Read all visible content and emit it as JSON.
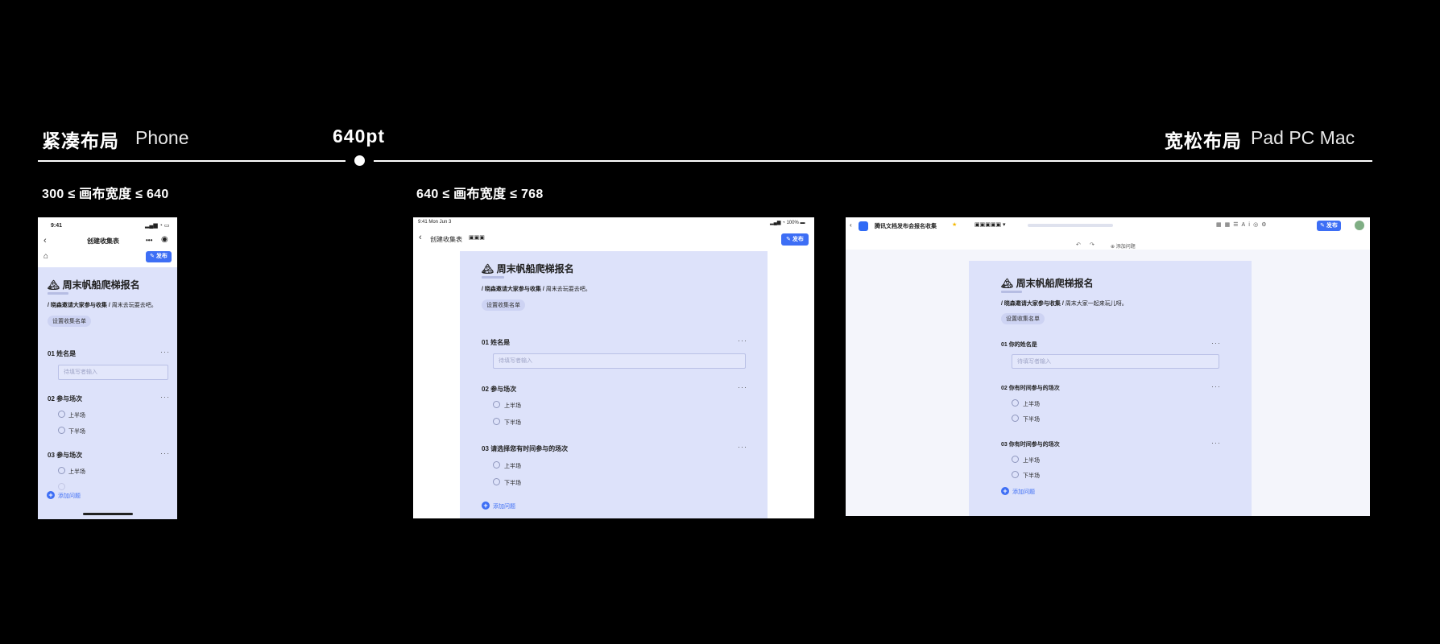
{
  "header": {
    "compact_label": "紧凑布局",
    "compact_devices": "Phone",
    "breakpoint": "640pt",
    "loose_label": "宽松布局",
    "loose_devices": "Pad PC Mac"
  },
  "ranges": {
    "phone": "300 ≤ 画布宽度 ≤ 640",
    "pad": "640 ≤ 画布宽度 ≤ 768"
  },
  "phone": {
    "time": "9:41",
    "title": "创建收集表",
    "publish": "发布",
    "form_title": "周末帆船爬梯报名",
    "desc_bold": "/ 晓森邀请大家参与收集 /",
    "desc": "周末去玩耍去吧。",
    "set_list": "设置收集名单",
    "q1": "01  姓名是",
    "q1_placeholder": "待填写者输入",
    "q2": "02  参与场次",
    "opt_a": "上半场",
    "opt_b": "下半场",
    "q3": "03  参与场次",
    "add": "添加问题",
    "more": "···"
  },
  "pad": {
    "time": "9:41  Mon Jun 3",
    "battery": "100%",
    "title": "创建收集表",
    "publish": "发布",
    "form_title": "周末帆船爬梯报名",
    "desc_bold": "/ 晓森邀请大家参与收集 /",
    "desc": "周末去玩耍去吧。",
    "set_list": "设置收集名单",
    "q1": "01  姓名是",
    "q1_placeholder": "待填写者输入",
    "q2": "02  参与场次",
    "opt_a": "上半场",
    "opt_b": "下半场",
    "q3": "03  请选择您有时间参与的场次",
    "add": "添加问题",
    "more": "···"
  },
  "pc": {
    "doc_title": "腾讯文档发布会报名收集",
    "publish": "发布",
    "undo": "↶",
    "redo": "↷",
    "add_top": "添加问题",
    "form_title": "周末帆船爬梯报名",
    "desc_bold": "/ 晓森邀请大家参与收集 /",
    "desc": "周末大家一起来玩儿呀。",
    "set_list": "设置收集名单",
    "q1": "01  你的姓名是",
    "q1_placeholder": "待填写者输入",
    "q2": "02  你有时间参与的场次",
    "opt_a": "上半场",
    "opt_b": "下半场",
    "q3": "03  你有时间参与的场次",
    "add": "添加问题",
    "more": "···"
  },
  "colors": {
    "accent": "#3d6ef5",
    "form_bg": "#dde2fa",
    "page_bg": "#000000"
  }
}
